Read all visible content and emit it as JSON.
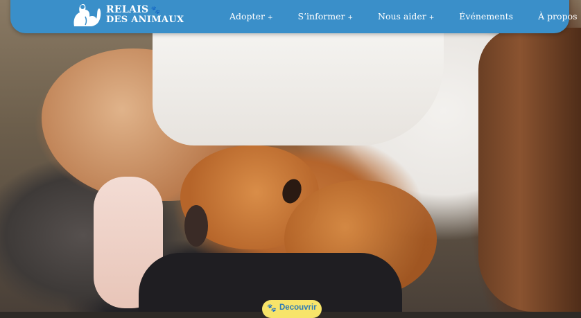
{
  "brand": {
    "line1": "Relais",
    "line2": "des Animaux",
    "line1_display": "RELAIS",
    "line2_display": "DES ANIMAUX"
  },
  "nav": {
    "items": [
      {
        "label": "Adopter",
        "has_submenu": true
      },
      {
        "label": "S’informer",
        "has_submenu": true
      },
      {
        "label": "Nous aider",
        "has_submenu": true
      },
      {
        "label": "Événements",
        "has_submenu": false
      },
      {
        "label": "À propos",
        "has_submenu": false
      }
    ],
    "submenu_marker": "+"
  },
  "hero": {
    "cta_label": "Decouvrir",
    "cta_icon": "paw-icon"
  },
  "colors": {
    "navbar": "#3a8fc9",
    "cta_bg": "#f7e46a",
    "cta_text": "#2f7bb4",
    "text_light": "#ffffff"
  }
}
